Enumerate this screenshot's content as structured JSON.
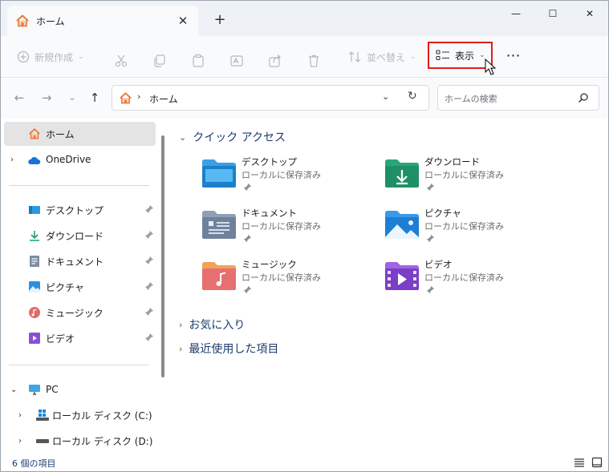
{
  "tab": {
    "title": "ホーム",
    "close_glyph": "✕",
    "new_tab_glyph": "+"
  },
  "window_controls": {
    "minimize": "—",
    "maximize": "☐",
    "close": "✕"
  },
  "toolbar": {
    "new_label": "新規作成",
    "sort_label": "並べ替え",
    "view_label": "表示",
    "more_glyph": "⋯"
  },
  "address": {
    "path_label": "ホーム",
    "search_placeholder": "ホームの検索"
  },
  "sidebar": {
    "home": "ホーム",
    "onedrive": "OneDrive",
    "pinned": [
      {
        "label": "デスクトップ",
        "icon": "desktop-icon"
      },
      {
        "label": "ダウンロード",
        "icon": "download-icon"
      },
      {
        "label": "ドキュメント",
        "icon": "documents-icon"
      },
      {
        "label": "ピクチャ",
        "icon": "pictures-icon"
      },
      {
        "label": "ミュージック",
        "icon": "music-icon"
      },
      {
        "label": "ビデオ",
        "icon": "videos-icon"
      }
    ],
    "pc": "PC",
    "drives": [
      {
        "label": "ローカル ディスク (C:)",
        "icon": "windows-drive-icon"
      },
      {
        "label": "ローカル ディスク (D:)",
        "icon": "drive-icon"
      }
    ]
  },
  "quick_access": {
    "title": "クイック アクセス",
    "items": [
      {
        "name": "デスクトップ",
        "sub": "ローカルに保存済み",
        "icon": "desktop-folder-icon"
      },
      {
        "name": "ダウンロード",
        "sub": "ローカルに保存済み",
        "icon": "download-folder-icon"
      },
      {
        "name": "ドキュメント",
        "sub": "ローカルに保存済み",
        "icon": "documents-folder-icon"
      },
      {
        "name": "ピクチャ",
        "sub": "ローカルに保存済み",
        "icon": "pictures-folder-icon"
      },
      {
        "name": "ミュージック",
        "sub": "ローカルに保存済み",
        "icon": "music-folder-icon"
      },
      {
        "name": "ビデオ",
        "sub": "ローカルに保存済み",
        "icon": "videos-folder-icon"
      }
    ]
  },
  "sections": {
    "favorites": "お気に入り",
    "recent": "最近使用した項目"
  },
  "status": {
    "item_count": "6 個の項目"
  }
}
